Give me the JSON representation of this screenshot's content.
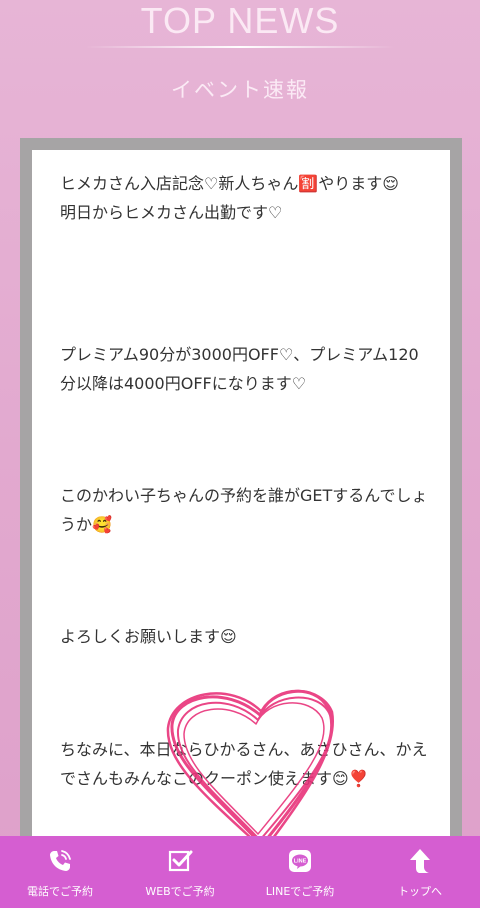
{
  "header": {
    "title": "TOP NEWS",
    "subtitle": "イベント速報"
  },
  "news": {
    "paragraphs": [
      "ヒメカさん入店記念♡新人ちゃん🈹やります😌\n明日からヒメカさん出勤です♡",
      "プレミアム90分が3000円OFF♡、プレミアム120分以降は4000円OFFになります♡",
      "このかわい子ちゃんの予約を誰がGETするんでしょうか🥰",
      "よろしくお願いします😌",
      "ちなみに、本日ならひかるさん、あさひさん、かえでさんもみんなこのクーポン使えます😊❣️"
    ]
  },
  "nav": {
    "items": [
      {
        "label": "電話でご予約",
        "icon": "phone-icon"
      },
      {
        "label": "WEBでご予約",
        "icon": "web-check-icon"
      },
      {
        "label": "LINEでご予約",
        "icon": "line-icon"
      },
      {
        "label": "トップへ",
        "icon": "arrow-up-icon"
      }
    ]
  },
  "colors": {
    "background": "#e2a9cf",
    "nav_background": "#d55ed1",
    "heart_stroke": "#e8337a"
  }
}
